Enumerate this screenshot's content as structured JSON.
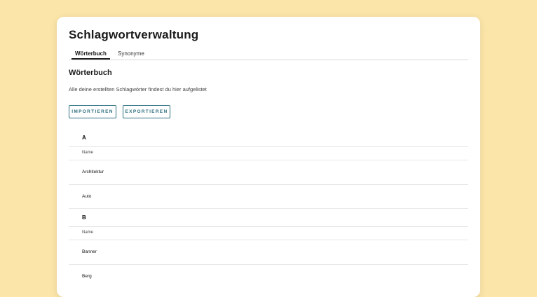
{
  "page": {
    "title": "Schlagwortverwaltung"
  },
  "tabs": [
    {
      "label": "Wörterbuch",
      "active": true
    },
    {
      "label": "Synonyme",
      "active": false
    }
  ],
  "section": {
    "title": "Wörterbuch",
    "subtitle": "Alle deine erstellten Schlagwörter findest du hier aufgelistet"
  },
  "actions": {
    "import_label": "IMPORTIEREN",
    "export_label": "EXPORTIEREN"
  },
  "groups": [
    {
      "letter": "A",
      "column_header": "Name",
      "rows": [
        "Architektur",
        "Auto"
      ]
    },
    {
      "letter": "B",
      "column_header": "Name",
      "rows": [
        "Banner",
        "Berg"
      ]
    }
  ],
  "colors": {
    "background": "#fbe5a8",
    "accent": "#2d6e7e",
    "card": "#ffffff"
  }
}
